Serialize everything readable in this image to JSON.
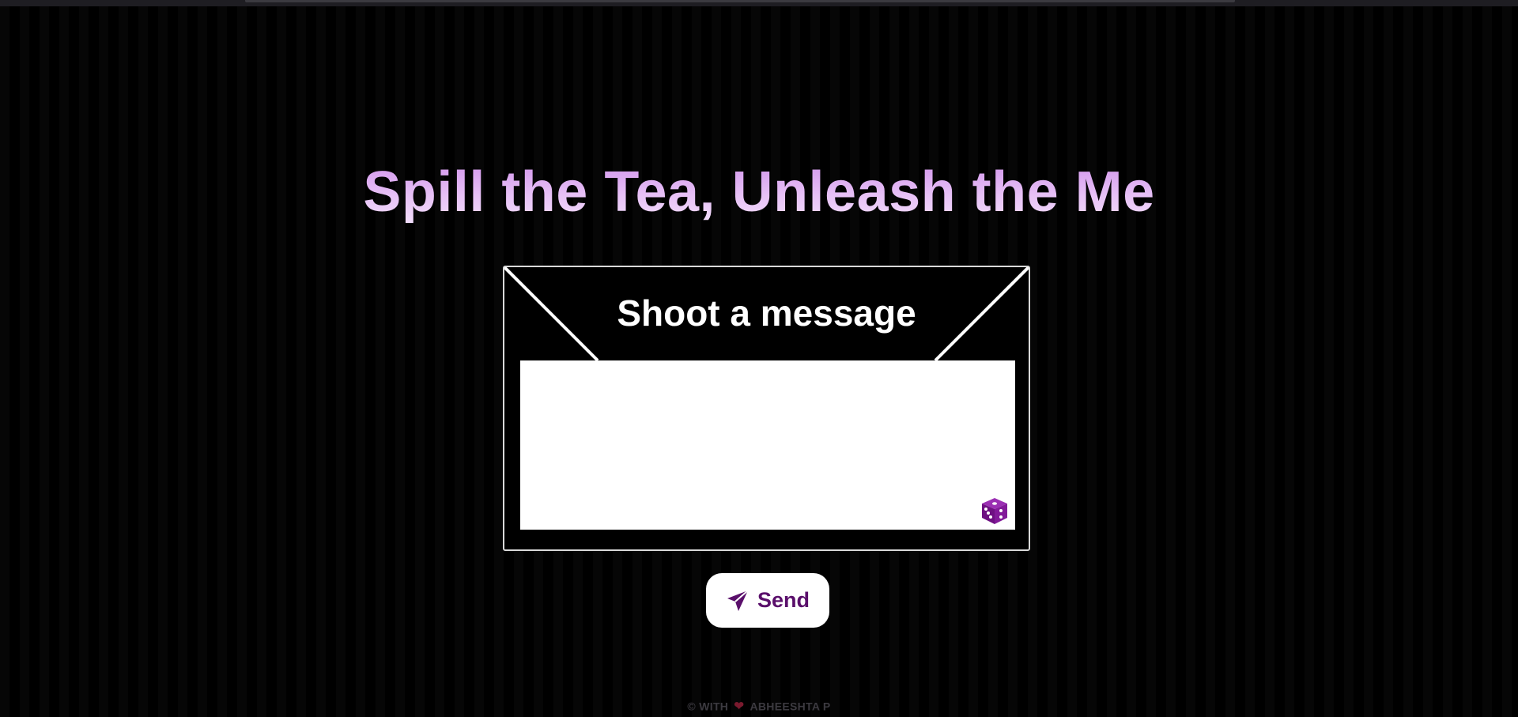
{
  "hero": {
    "title": "Spill the Tea, Unleash the Me"
  },
  "envelope": {
    "heading": "Shoot a message",
    "message_value": "",
    "dice_icon": "dice-icon"
  },
  "send_button": {
    "label": "Send",
    "icon": "paper-plane-icon"
  },
  "footer": {
    "copyright": "©",
    "with": "WITH",
    "heart_icon": "heart-icon",
    "author": "ABHEESHTA P"
  },
  "colors": {
    "title_gradient_top": "#cf8fea",
    "title_gradient_bottom": "#f3e2fb",
    "accent_purple": "#5a0f6b",
    "dice_purple": "#7d1791",
    "background": "#000000"
  }
}
